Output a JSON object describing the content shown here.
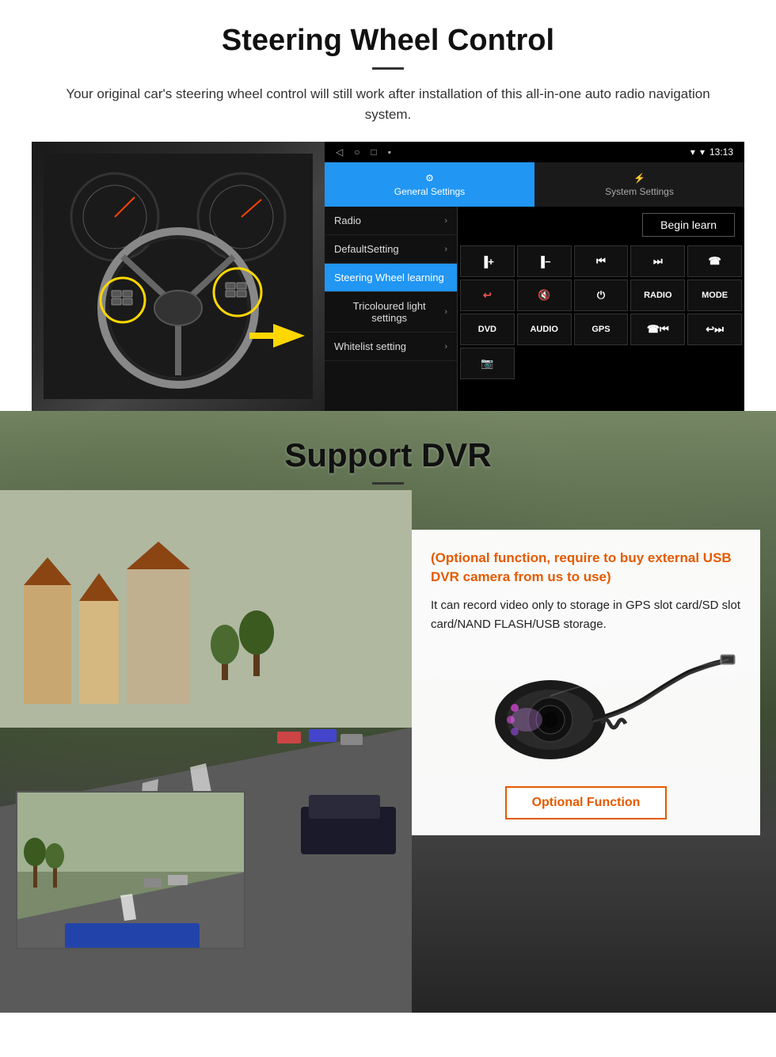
{
  "steering_section": {
    "title": "Steering Wheel Control",
    "description": "Your original car's steering wheel control will still work after installation of this all-in-one auto radio navigation system.",
    "android_panel": {
      "time": "13:13",
      "tab_general": "General Settings",
      "tab_system": "System Settings",
      "menu_items": [
        {
          "label": "Radio",
          "active": false
        },
        {
          "label": "DefaultSetting",
          "active": false
        },
        {
          "label": "Steering Wheel learning",
          "active": true
        },
        {
          "label": "Tricoloured light settings",
          "active": false
        },
        {
          "label": "Whitelist setting",
          "active": false
        }
      ],
      "begin_learn": "Begin learn",
      "control_buttons": [
        "vol+",
        "vol-",
        "|<",
        ">|",
        "☎",
        "↩",
        "🔇",
        "⏻",
        "RADIO",
        "MODE",
        "DVD",
        "AUDIO",
        "GPS",
        "☎|<",
        "↩>|",
        "📷"
      ]
    }
  },
  "dvr_section": {
    "title": "Support DVR",
    "optional_text": "(Optional function, require to buy external USB DVR camera from us to use)",
    "description": "It can record video only to storage in GPS slot card/SD slot card/NAND FLASH/USB storage.",
    "optional_function_label": "Optional Function"
  }
}
